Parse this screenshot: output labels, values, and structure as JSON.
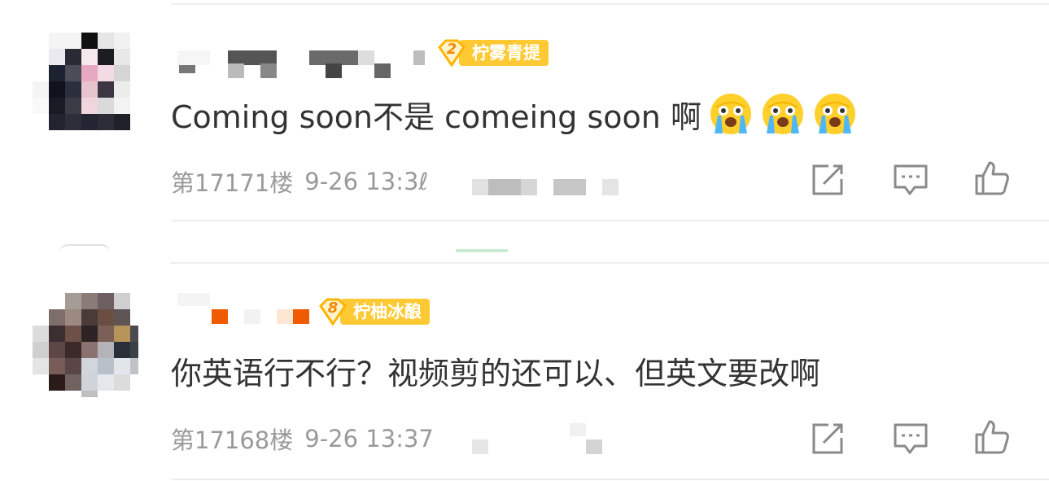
{
  "comments": [
    {
      "badge_level": "2",
      "badge_name": "柠雾青提",
      "text": "Coming soon不是 comeing soon 啊",
      "emoji_icon": "crying-face-icon",
      "emoji_count": 3,
      "floor": "第17171楼",
      "time": "9-26 13:3ℓ"
    },
    {
      "badge_level": "8",
      "badge_name": "柠柚冰酿",
      "text": "你英语行不行？视频剪的还可以、但英文要改啊",
      "floor": "第17168楼",
      "time": "9-26 13:37"
    }
  ],
  "actions": [
    "share-icon",
    "reply-icon",
    "like-icon"
  ],
  "colors": {
    "badge_bg": "#ffc933",
    "badge_level_text": "#f08a00",
    "content_text": "#333333",
    "meta_text": "#9a9a9a",
    "icon_stroke": "#8a8a8a"
  }
}
